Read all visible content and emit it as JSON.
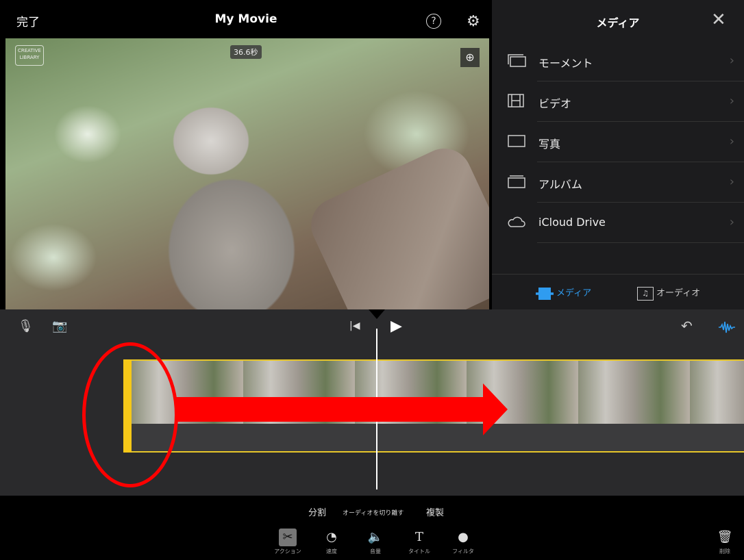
{
  "header": {
    "done_label": "完了",
    "title": "My Movie",
    "help_icon": "?",
    "gear_icon": "⚙"
  },
  "viewer": {
    "logo_text": "CREATIVE LIBRARY",
    "duration_badge": "36.6秒",
    "zoom_icon": "⊕"
  },
  "media_panel": {
    "title": "メディア",
    "close_icon": "✕",
    "items": [
      {
        "label": "モーメント",
        "icon": "moments-icon"
      },
      {
        "label": "ビデオ",
        "icon": "video-icon"
      },
      {
        "label": "写真",
        "icon": "photo-icon"
      },
      {
        "label": "アルバム",
        "icon": "album-icon"
      },
      {
        "label": "iCloud Drive",
        "icon": "cloud-icon"
      }
    ],
    "chevron": "›",
    "tabs": [
      {
        "label": "メディア",
        "active": true
      },
      {
        "label": "オーディオ",
        "active": false
      }
    ],
    "accent": "#2f9cf0"
  },
  "timeline": {
    "mic_icon": "🎙",
    "camera_icon": "📷",
    "undo_icon": "↶",
    "waveform_icon": "waveform-icon",
    "handle_color": "#f6c818"
  },
  "actions": {
    "split": "分割",
    "detach_audio": "オーディオを切り離す",
    "duplicate": "複製"
  },
  "tools": [
    {
      "label": "アクション",
      "icon": "✂"
    },
    {
      "label": "速度",
      "icon": "◔"
    },
    {
      "label": "音量",
      "icon": "🔈"
    },
    {
      "label": "タイトル",
      "icon": "T"
    },
    {
      "label": "フィルタ",
      "icon": "●"
    }
  ],
  "delete": {
    "label": "削除",
    "icon": "🗑"
  }
}
